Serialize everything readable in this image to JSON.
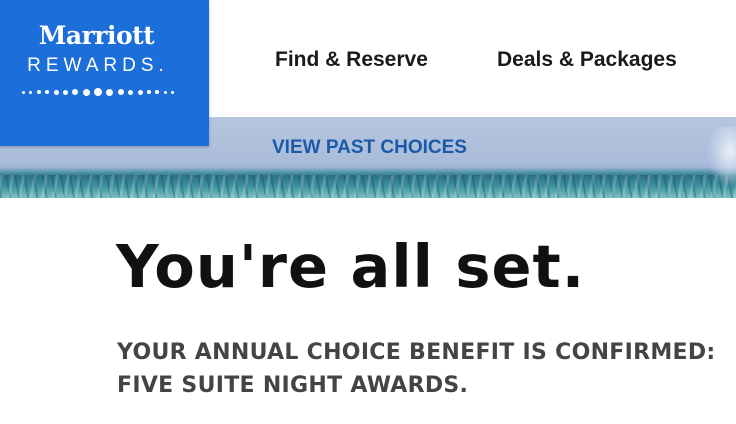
{
  "logo": {
    "wordmark": "Marriott",
    "subtitle": "REWARDS.",
    "brand_color": "#1c6fd8"
  },
  "nav": {
    "items": [
      {
        "label": "Find & Reserve"
      },
      {
        "label": "Deals & Packages"
      }
    ]
  },
  "hero": {
    "link_label": "VIEW PAST CHOICES",
    "link_color": "#1a5aa8"
  },
  "main": {
    "headline": "You're all set.",
    "confirmation_lines": [
      "YOUR ANNUAL CHOICE BENEFIT IS CONFIRMED:",
      "FIVE SUITE NIGHT AWARDS."
    ]
  }
}
